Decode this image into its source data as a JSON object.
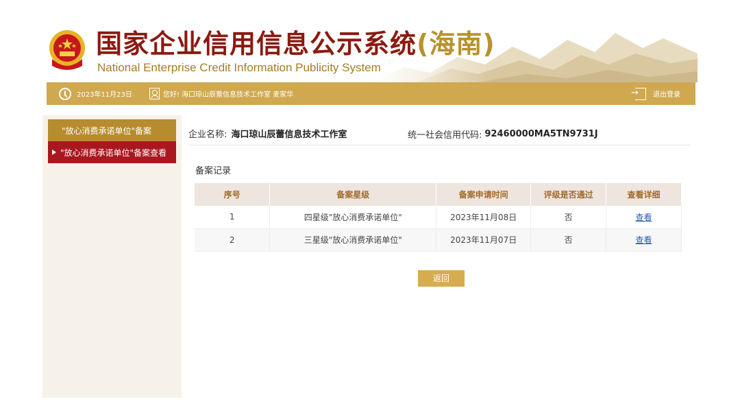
{
  "header": {
    "title_cn_main": "国家企业信用信息公示系统",
    "title_cn_region": "(海南)",
    "title_en": "National Enterprise Credit Information Publicity System"
  },
  "topbar": {
    "date": "2023年11月23日",
    "greeting": "您好!",
    "user": "海口琼山辰蕾信息技术工作室 麦家华",
    "logout": "退出登录"
  },
  "sidebar": {
    "items": [
      {
        "label": "\"放心消费承诺单位\"备案"
      },
      {
        "label": "\"放心消费承诺单位\"备案查看"
      }
    ]
  },
  "company": {
    "name_label": "企业名称:",
    "name": "海口琼山辰蕾信息技术工作室",
    "credit_label": "统一社会信用代码:",
    "credit_code": "92460000MA5TN9731J"
  },
  "records": {
    "title": "备案记录",
    "columns": [
      "序号",
      "备案星级",
      "备案申请时间",
      "评级是否通过",
      "查看详细"
    ],
    "rows": [
      {
        "no": "1",
        "level": "四星级\"放心消费承诺单位\"",
        "date": "2023年11月08日",
        "passed": "否",
        "link": "查看"
      },
      {
        "no": "2",
        "level": "三星级\"放心消费承诺单位\"",
        "date": "2023年11月07日",
        "passed": "否",
        "link": "查看"
      }
    ]
  },
  "back_button": "返回",
  "colors": {
    "gold": "#cfa850",
    "red": "#a9181e",
    "title_red": "#8b1a10"
  }
}
